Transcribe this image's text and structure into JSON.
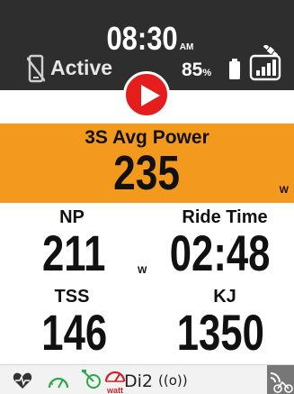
{
  "header": {
    "time": "08:30",
    "ampm": "AM",
    "activity_status": "Active",
    "battery_percent": "85",
    "battery_unit": "%"
  },
  "highlight_field": {
    "label": "3S Avg Power",
    "value": "235",
    "unit": "W"
  },
  "fields": [
    {
      "label": "NP",
      "value": "211",
      "unit": "W"
    },
    {
      "label": "Ride Time",
      "value": "02:48",
      "unit": ""
    },
    {
      "label": "TSS",
      "value": "146",
      "unit": ""
    },
    {
      "label": "KJ",
      "value": "1350",
      "unit": ""
    }
  ],
  "footer": {
    "icons": [
      "heart-rate-icon",
      "speed-sensor-icon",
      "cadence-sensor-icon",
      "power-meter-icon",
      "di2-icon",
      "ant-signal-icon",
      "bike-settings-icon"
    ],
    "power_meter_label": "watt",
    "di2_label": "Di2",
    "signal_label": "((o))"
  },
  "colors": {
    "header_bg": "#2e2e2e",
    "highlight_bg": "#f39a1e",
    "play_button": "#e51d1d",
    "sensor_green": "#2aa84a",
    "power_red": "#d21f26"
  }
}
